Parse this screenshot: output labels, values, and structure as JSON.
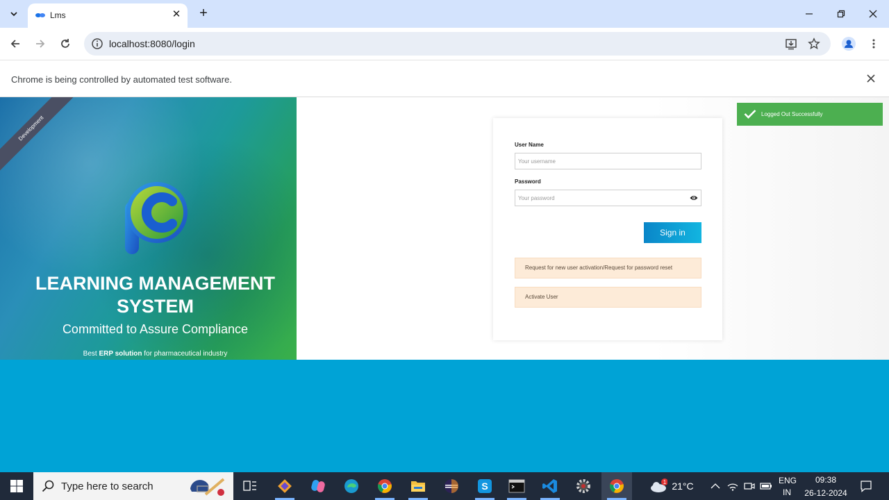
{
  "browser": {
    "tab_title": "Lms",
    "url": "localhost:8080/login",
    "infobar_text": "Chrome is being controlled by automated test software."
  },
  "hero": {
    "ribbon": "Development",
    "title": "LEARNING MANAGEMENT SYSTEM",
    "subtitle": "Committed to Assure Compliance",
    "tagline_pre": "Best ",
    "tagline_bold": "ERP solution",
    "tagline_post": " for pharmaceutical industry"
  },
  "login": {
    "username_label": "User Name",
    "username_placeholder": "Your username",
    "password_label": "Password",
    "password_placeholder": "Your password",
    "signin_label": "Sign in",
    "request_link": "Request for new user activation/Request for password reset",
    "activate_link": "Activate User"
  },
  "toast": {
    "message": "Logged Out Successfully",
    "color": "#4caf50"
  },
  "taskbar": {
    "search_placeholder": "Type here to search",
    "weather_temp": "21°C",
    "weather_badge": "1",
    "lang_line1": "ENG",
    "lang_line2": "IN",
    "time": "09:38",
    "date": "26-12-2024"
  }
}
